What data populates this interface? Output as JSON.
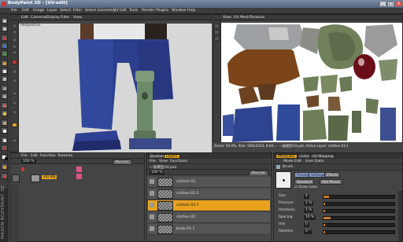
{
  "app": {
    "title": "BodyPaint 3D - [UV-edit]"
  },
  "window_controls": [
    "_",
    "□",
    "×"
  ],
  "menu": [
    "File",
    "Edit",
    "Image",
    "Layer",
    "Select",
    "Filter",
    "Select Geometry",
    "UV Edit",
    "Tools",
    "Render",
    "Plugins",
    "Window",
    "Help"
  ],
  "left_view": {
    "menu": [
      "Edit",
      "Cameras",
      "Display",
      "Filter",
      "View"
    ],
    "label": "Perspective"
  },
  "right_view": {
    "menu": [
      "View",
      "UV Mesh",
      "Textures"
    ],
    "status": "Zoom: 50.0%, Size: 500x1024, 8 Bit, -- 一般模型UV.psd, Active Layer: clothes-03-1"
  },
  "objects_panel": {
    "menu": [
      "File",
      "Edit",
      "Function",
      "Textures"
    ],
    "object_name": "ver.obj",
    "mode": "Normal"
  },
  "layers_panel": {
    "tabs": [
      "Brushes",
      "Layers"
    ],
    "menu": [
      "File",
      "View",
      "Functions"
    ],
    "file": "一般模型UV.psd",
    "blend_mode": "Normal",
    "layers": [
      "clothes-03",
      "clothes-02-2",
      "clothes-03-1",
      "clothes-02",
      "body-03-1"
    ],
    "active_index": 2
  },
  "attributes_panel": {
    "tabs": [
      "Attributes",
      "Color",
      "UV Mapping"
    ],
    "menu": [
      "Mode",
      "Edit",
      "User Data"
    ],
    "section": "Brush",
    "sub_tabs": [
      "Presets",
      "Settings",
      "Effects"
    ],
    "buttons": [
      "Standard",
      "Add Preset"
    ],
    "checkbox": "Draw Color",
    "rows": [
      {
        "label": "Size",
        "value": "4",
        "fill": 0.08
      },
      {
        "label": "Pressure",
        "value": "1 %",
        "fill": 0.01
      },
      {
        "label": "Hardness",
        "value": "1 %",
        "fill": 0.01
      },
      {
        "label": "Spacing",
        "value": "10 %",
        "fill": 0.1
      },
      {
        "label": "Use",
        "value": "0",
        "fill": 0.0
      },
      {
        "label": "Rotation",
        "value": "0 °",
        "fill": 0.0
      }
    ]
  },
  "brand": "MAXON BODYPAINT 3D"
}
